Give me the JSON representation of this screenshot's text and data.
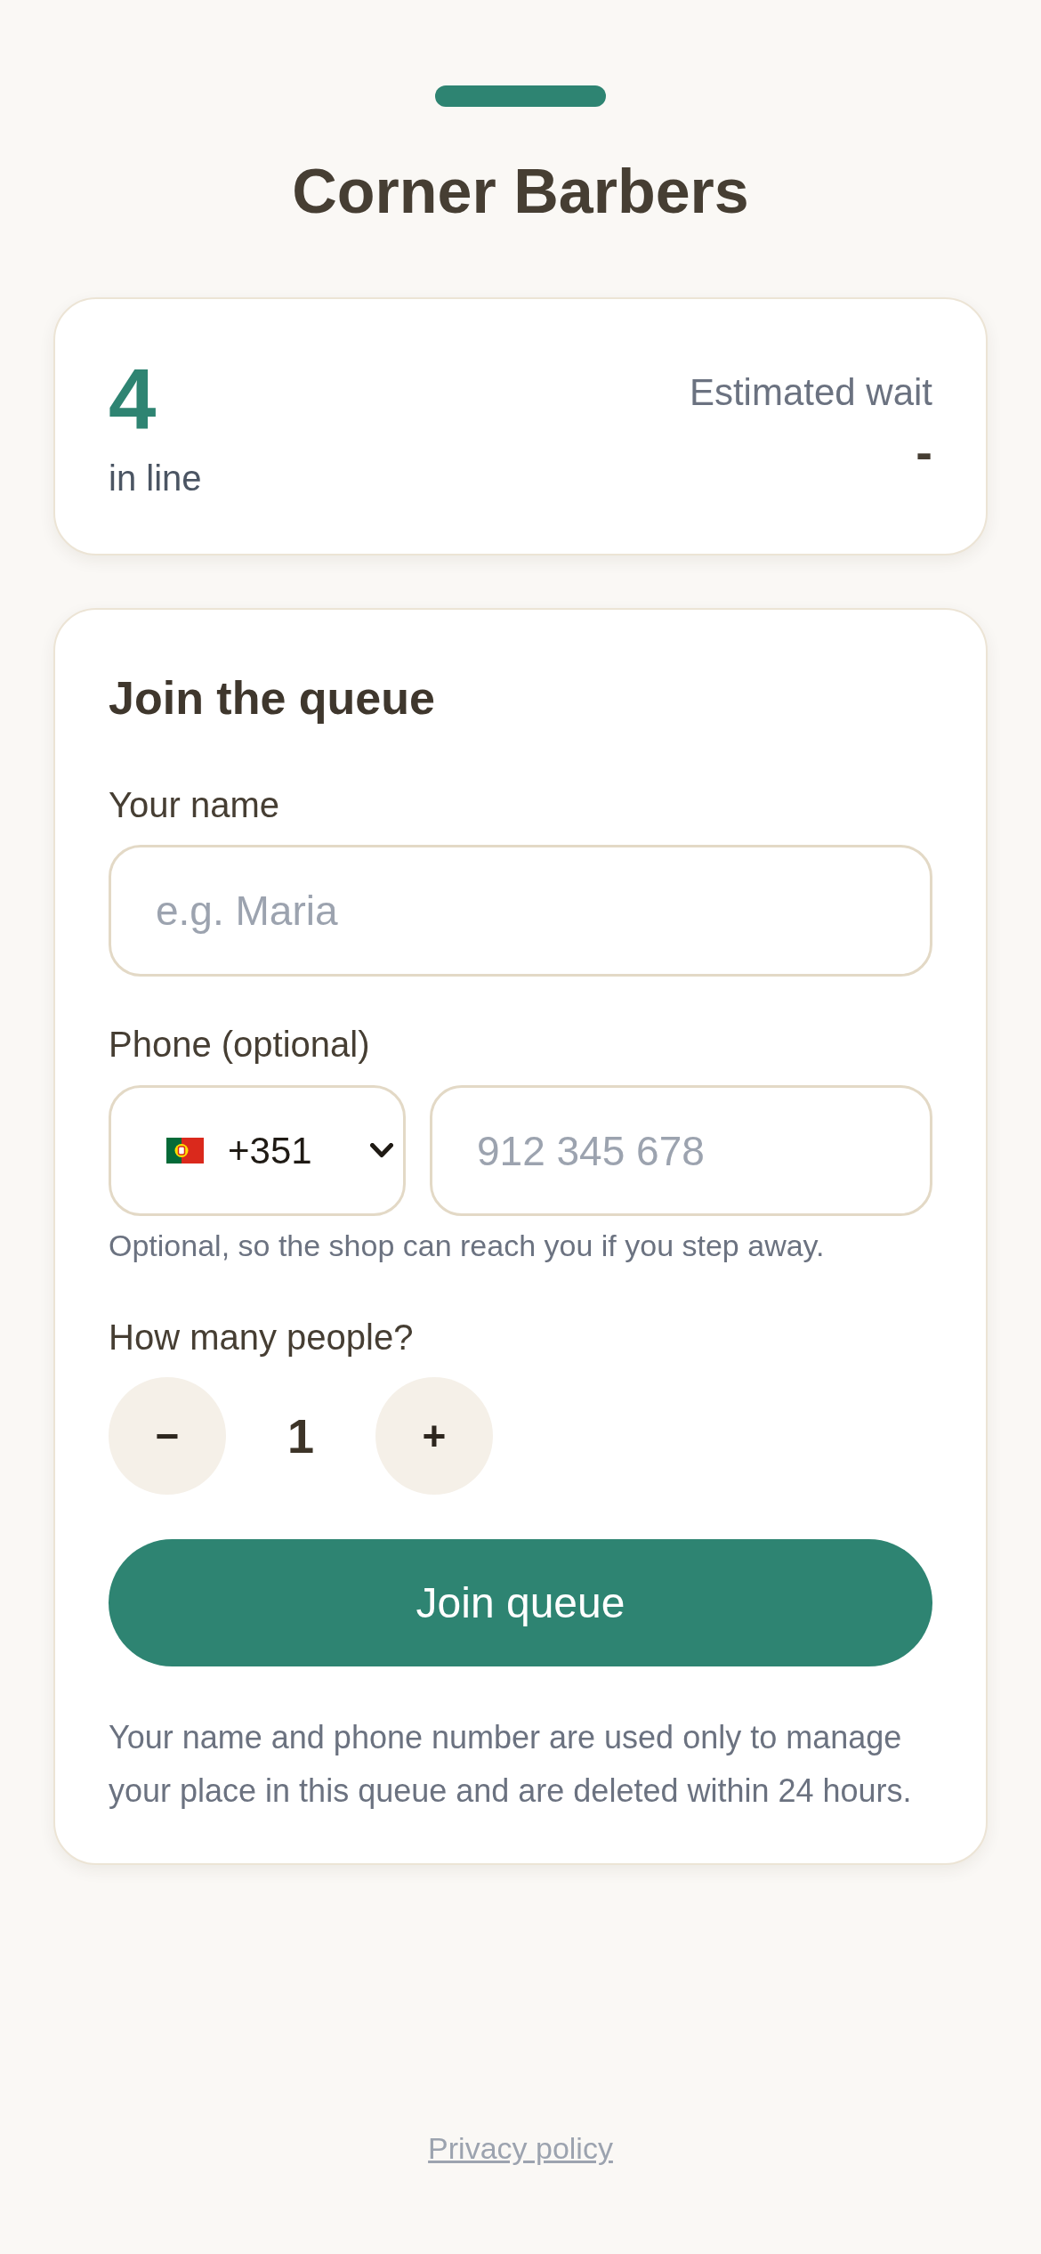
{
  "header": {
    "title": "Corner Barbers"
  },
  "status_card": {
    "count": "4",
    "count_label": "in line",
    "wait_label": "Estimated wait",
    "wait_value": "-"
  },
  "form": {
    "title": "Join the queue",
    "name_field": {
      "label": "Your name",
      "placeholder": "e.g. Maria"
    },
    "phone_field": {
      "label": "Phone (optional)",
      "country_code": "+351",
      "placeholder": "912 345 678",
      "hint": "Optional, so the shop can reach you if you step away."
    },
    "party_size": {
      "label": "How many people?",
      "decrement": "−",
      "value": "1",
      "increment": "+"
    },
    "submit_button": "Join queue",
    "privacy_notice": "Your name and phone number are used only to manage your place in this queue and are deleted within 24 hours."
  },
  "footer": {
    "privacy_link": "Privacy policy"
  }
}
